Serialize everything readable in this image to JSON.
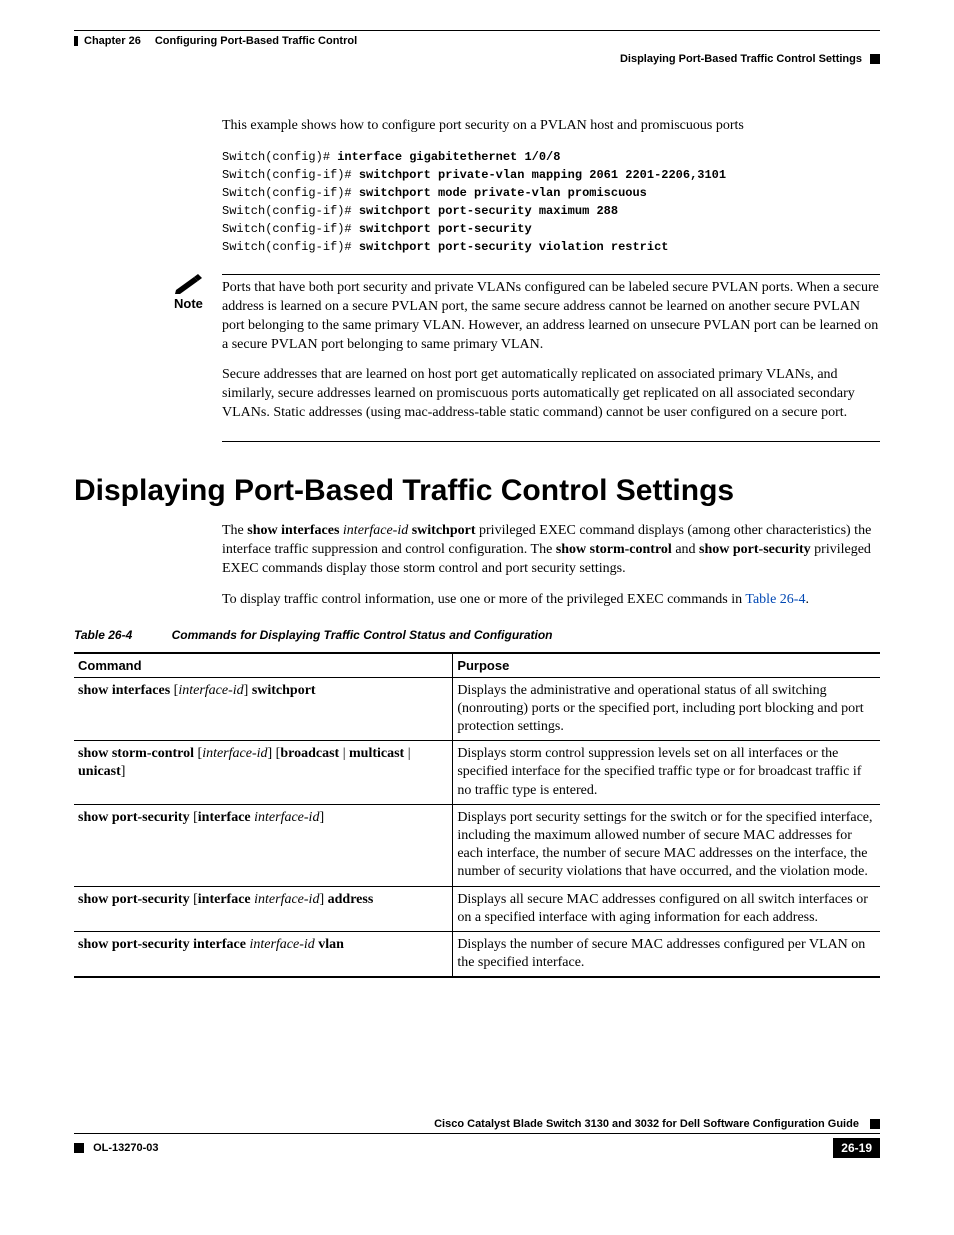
{
  "header": {
    "chapter": "Chapter 26",
    "chapter_title": "Configuring Port-Based Traffic Control",
    "breadcrumb": "Displaying Port-Based Traffic Control Settings"
  },
  "intro_para": "This example shows how to configure port security on a PVLAN host and promiscuous ports",
  "code": {
    "l1p": "Switch(config)# ",
    "l1b": "interface gigabitethernet 1/0/8",
    "l2p": "Switch(config-if)# ",
    "l2b": "switchport private-vlan mapping 2061 2201-2206,3101",
    "l3p": "Switch(config-if)# ",
    "l3b": "switchport mode private-vlan promiscuous",
    "l4p": "Switch(config-if)# ",
    "l4b": "switchport port-security maximum 288",
    "l5p": "Switch(config-if)# ",
    "l5b": "switchport port-security",
    "l6p": "Switch(config-if)# ",
    "l6b": "switchport port-security violation restrict"
  },
  "note": {
    "label": "Note",
    "para1": "Ports that have both port security and private VLANs configured can be labeled secure PVLAN ports. When a secure address is learned on a secure PVLAN port, the same secure address cannot be learned on another secure PVLAN port belonging to the same primary VLAN. However, an address learned on unsecure PVLAN port can be learned on a secure PVLAN port belonging to same primary VLAN.",
    "para2": "Secure addresses that are learned on host port get automatically replicated on associated primary VLANs, and similarly, secure addresses learned on promiscuous ports automatically get replicated on all associated secondary VLANs. Static addresses (using mac-address-table static command) cannot be user configured on a secure port."
  },
  "section_title": "Displaying Port-Based Traffic Control Settings",
  "section_para_parts": {
    "p1a": "The ",
    "p1b": "show interfaces",
    "p1c": " interface-id ",
    "p1d": "switchport",
    "p1e": " privileged EXEC command displays (among other characteristics) the interface traffic suppression and control configuration. The ",
    "p1f": "show storm-control",
    "p1g": " and ",
    "p1h": "show port-security",
    "p1i": " privileged EXEC commands display those storm control and port security settings."
  },
  "section_para2_a": "To display traffic control information, use one or more of the privileged EXEC commands in ",
  "section_para2_link": "Table 26-4",
  "section_para2_b": ".",
  "table": {
    "number": "Table 26-4",
    "title": "Commands for Displaying Traffic Control Status and Configuration",
    "h1": "Command",
    "h2": "Purpose",
    "r1": {
      "c1a": "show interfaces ",
      "c1b": "[",
      "c1c": "interface-id",
      "c1d": "] ",
      "c1e": "switchport",
      "purpose": "Displays the administrative and operational status of all switching (nonrouting) ports or the specified port, including port blocking and port protection settings."
    },
    "r2": {
      "c1a": "show storm-control ",
      "c1b": "[",
      "c1c": "interface-id",
      "c1d": "] [",
      "c1e": "broadcast",
      "c1f": " | ",
      "c1g": "multicast",
      "c1h": " | ",
      "c1i": "unicast",
      "c1j": "]",
      "purpose": "Displays storm control suppression levels set on all interfaces or the specified interface for the specified traffic type or for broadcast traffic if no traffic type is entered."
    },
    "r3": {
      "c1a": "show port-security ",
      "c1b": "[",
      "c1c": "interface ",
      "c1d": "interface-id",
      "c1e": "]",
      "purpose": "Displays port security settings for the switch or for the specified interface, including the maximum allowed number of secure MAC addresses for each interface, the number of secure MAC addresses on the interface, the number of security violations that have occurred, and the violation mode."
    },
    "r4": {
      "c1a": "show port-security ",
      "c1b": "[",
      "c1c": "interface ",
      "c1d": "interface-id",
      "c1e": "] ",
      "c1f": "address",
      "purpose": "Displays all secure MAC addresses configured on all switch interfaces or on a specified interface with aging information for each address."
    },
    "r5": {
      "c1a": "show port-security interface ",
      "c1b": "interface-id ",
      "c1c": "vlan",
      "purpose": "Displays the number of secure MAC addresses configured per VLAN on the specified interface."
    }
  },
  "footer": {
    "doc_title": "Cisco Catalyst Blade Switch 3130 and 3032 for Dell Software Configuration Guide",
    "ol": "OL-13270-03",
    "page": "26-19"
  }
}
